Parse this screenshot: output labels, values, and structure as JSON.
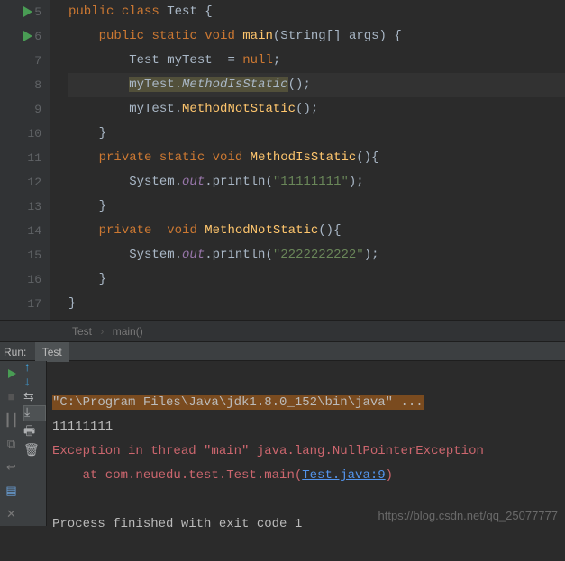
{
  "editor": {
    "lines": [
      {
        "n": 5,
        "run": true,
        "tokens": [
          {
            "c": "kw",
            "t": "public"
          },
          {
            "c": "",
            "t": " "
          },
          {
            "c": "kw",
            "t": "class"
          },
          {
            "c": "",
            "t": " "
          },
          {
            "c": "type",
            "t": "Test"
          },
          {
            "c": "",
            "t": " {"
          }
        ]
      },
      {
        "n": 6,
        "run": true,
        "indent": 1,
        "tokens": [
          {
            "c": "kw",
            "t": "public"
          },
          {
            "c": "",
            "t": " "
          },
          {
            "c": "kw",
            "t": "static"
          },
          {
            "c": "",
            "t": " "
          },
          {
            "c": "kw",
            "t": "void"
          },
          {
            "c": "",
            "t": " "
          },
          {
            "c": "method-def",
            "t": "main"
          },
          {
            "c": "",
            "t": "("
          },
          {
            "c": "type",
            "t": "String"
          },
          {
            "c": "",
            "t": "[] "
          },
          {
            "c": "param",
            "t": "args"
          },
          {
            "c": "",
            "t": ") {"
          }
        ]
      },
      {
        "n": 7,
        "indent": 2,
        "tokens": [
          {
            "c": "type",
            "t": "Test"
          },
          {
            "c": "",
            "t": " myTest  = "
          },
          {
            "c": "kw",
            "t": "null"
          },
          {
            "c": "",
            "t": ";"
          }
        ]
      },
      {
        "n": 8,
        "hl": true,
        "indent": 2,
        "tokens": [
          {
            "c": "",
            "t": "",
            "warn": true,
            "wt": "myTest."
          },
          {
            "c": "",
            "t": "",
            "warnItalic": true,
            "wt": "MethodIsStatic"
          },
          {
            "c": "",
            "t": "();"
          }
        ]
      },
      {
        "n": 9,
        "indent": 2,
        "tokens": [
          {
            "c": "",
            "t": "myTest."
          },
          {
            "c": "method-def",
            "t": "MethodNotStatic"
          },
          {
            "c": "",
            "t": "();"
          }
        ]
      },
      {
        "n": 10,
        "indent": 1,
        "tokens": [
          {
            "c": "",
            "t": "}"
          }
        ]
      },
      {
        "n": 11,
        "indent": 1,
        "tokens": [
          {
            "c": "kw",
            "t": "private"
          },
          {
            "c": "",
            "t": " "
          },
          {
            "c": "kw",
            "t": "static"
          },
          {
            "c": "",
            "t": " "
          },
          {
            "c": "kw",
            "t": "void"
          },
          {
            "c": "",
            "t": " "
          },
          {
            "c": "method-def",
            "t": "MethodIsStatic"
          },
          {
            "c": "",
            "t": "(){"
          }
        ]
      },
      {
        "n": 12,
        "indent": 2,
        "tokens": [
          {
            "c": "sys",
            "t": "System."
          },
          {
            "c": "field",
            "t": "out"
          },
          {
            "c": "",
            "t": ".println("
          },
          {
            "c": "str",
            "t": "\"11111111\""
          },
          {
            "c": "",
            "t": ");"
          }
        ]
      },
      {
        "n": 13,
        "indent": 1,
        "tokens": [
          {
            "c": "",
            "t": "}"
          }
        ]
      },
      {
        "n": 14,
        "indent": 1,
        "tokens": [
          {
            "c": "kw",
            "t": "private"
          },
          {
            "c": "",
            "t": "  "
          },
          {
            "c": "kw",
            "t": "void"
          },
          {
            "c": "",
            "t": " "
          },
          {
            "c": "method-def",
            "t": "MethodNotStatic"
          },
          {
            "c": "",
            "t": "(){"
          }
        ]
      },
      {
        "n": 15,
        "indent": 2,
        "tokens": [
          {
            "c": "sys",
            "t": "System."
          },
          {
            "c": "field",
            "t": "out"
          },
          {
            "c": "",
            "t": ".println("
          },
          {
            "c": "str",
            "t": "\"2222222222\""
          },
          {
            "c": "",
            "t": ");"
          }
        ]
      },
      {
        "n": 16,
        "indent": 1,
        "tokens": [
          {
            "c": "",
            "t": "}"
          }
        ]
      },
      {
        "n": 17,
        "tokens": [
          {
            "c": "",
            "t": "}"
          }
        ]
      }
    ]
  },
  "breadcrumb": {
    "class": "Test",
    "method": "main()"
  },
  "runbar": {
    "label": "Run:",
    "tab": "Test"
  },
  "console": {
    "cmd": "\"C:\\Program Files\\Java\\jdk1.8.0_152\\bin\\java\" ...",
    "out1": "11111111",
    "err1": "Exception in thread \"main\" java.lang.NullPointerException",
    "err2_pre": "    at com.neuedu.test.Test.main(",
    "err2_link": "Test.java:9",
    "err2_post": ")",
    "exit": "Process finished with exit code 1"
  },
  "watermark": "https://blog.csdn.net/qq_25077777"
}
